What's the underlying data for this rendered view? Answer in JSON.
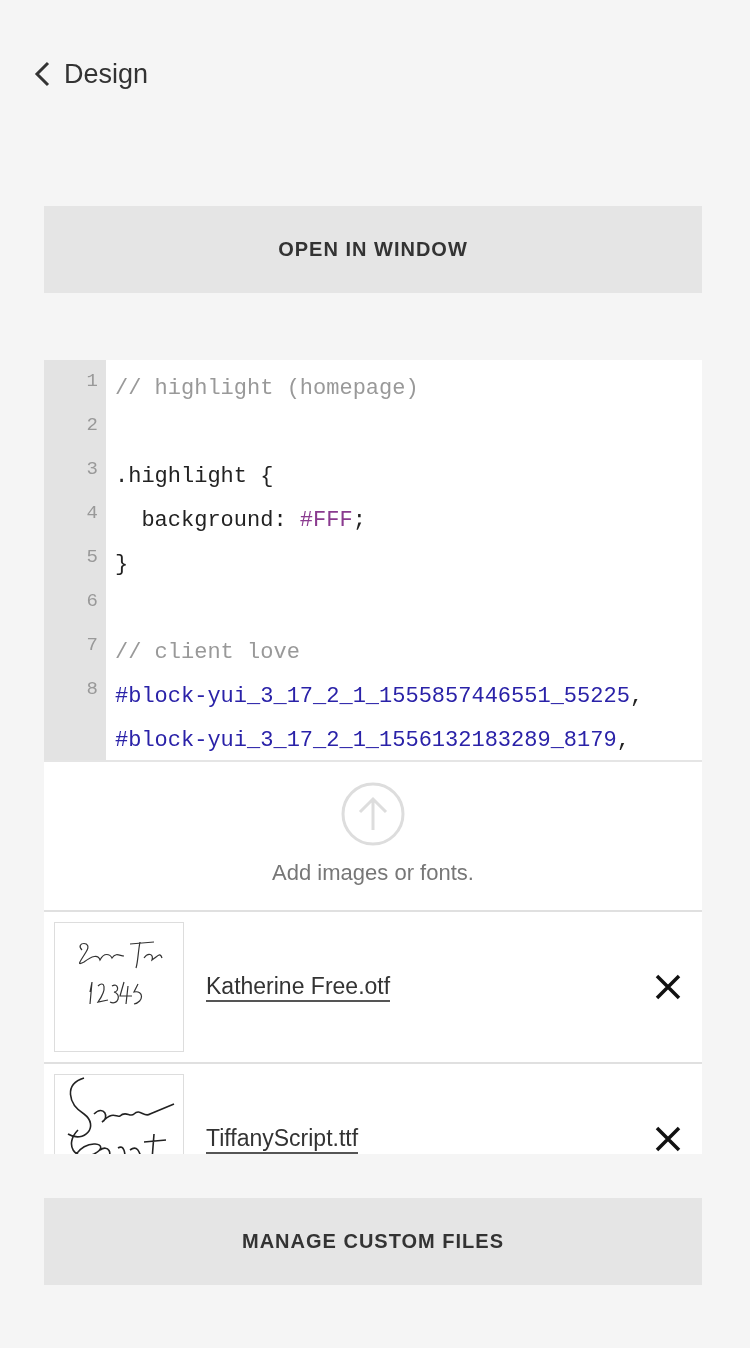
{
  "header": {
    "back_label": "Design"
  },
  "open_button": "OPEN IN WINDOW",
  "editor": {
    "lines": [
      {
        "number": "1",
        "tokens": [
          {
            "kind": "comment",
            "text": "// highlight (homepage)"
          }
        ]
      },
      {
        "number": "2"
      },
      {
        "number": "3",
        "tokens": [
          {
            "kind": "plain",
            "text": ".highlight {"
          }
        ]
      },
      {
        "number": "4",
        "tokens": [
          {
            "kind": "plain",
            "text": "  background: "
          },
          {
            "kind": "value",
            "text": "#FFF"
          },
          {
            "kind": "plain",
            "text": ";"
          }
        ]
      },
      {
        "number": "5",
        "tokens": [
          {
            "kind": "plain",
            "text": "}"
          }
        ]
      },
      {
        "number": "6"
      },
      {
        "number": "7",
        "tokens": [
          {
            "kind": "comment",
            "text": "// client love"
          }
        ]
      },
      {
        "number": "8",
        "tokens": [
          {
            "kind": "selector",
            "text": "#block-yui_3_17_2_1_1555857446551_55225"
          },
          {
            "kind": "plain",
            "text": ","
          }
        ]
      },
      {
        "tokens": [
          {
            "kind": "selector",
            "text": "#block-yui_3_17_2_1_1556132183289_8179"
          },
          {
            "kind": "plain",
            "text": ","
          }
        ]
      }
    ]
  },
  "upload": {
    "label": "Add images or fonts."
  },
  "files": [
    {
      "name": "Katherine Free.otf"
    },
    {
      "name": "TiffanyScript.ttf"
    }
  ],
  "manage_button": "MANAGE CUSTOM FILES"
}
